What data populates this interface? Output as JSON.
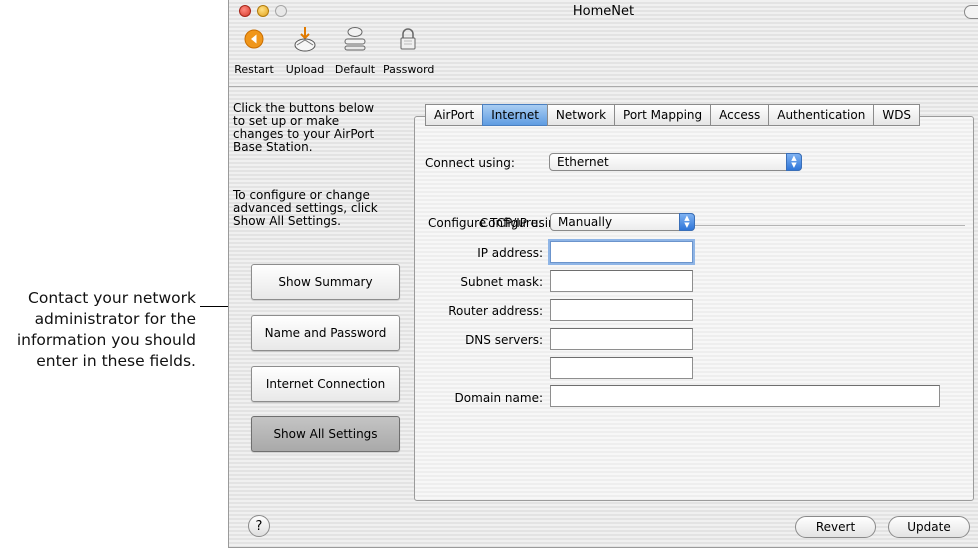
{
  "annotation": {
    "lines": [
      "Contact your network",
      "administrator for the",
      "information you should",
      "enter in these fields."
    ]
  },
  "window": {
    "title": "HomeNet"
  },
  "toolbar": {
    "items": [
      {
        "label": "Restart",
        "icon": "restart-icon"
      },
      {
        "label": "Upload",
        "icon": "upload-icon"
      },
      {
        "label": "Default",
        "icon": "default-icon"
      },
      {
        "label": "Password",
        "icon": "lock-icon"
      }
    ]
  },
  "sidebar": {
    "instructions_1": [
      "Click the buttons below",
      "to set up or make",
      "changes to your AirPort",
      "Base Station."
    ],
    "instructions_2": [
      "To configure or change",
      "advanced settings, click",
      "Show All Settings."
    ],
    "buttons": [
      {
        "label": "Show Summary"
      },
      {
        "label": "Name and Password"
      },
      {
        "label": "Internet Connection"
      },
      {
        "label": "Show All Settings",
        "active": true
      }
    ]
  },
  "tabs": [
    {
      "label": "AirPort"
    },
    {
      "label": "Internet",
      "active": true
    },
    {
      "label": "Network"
    },
    {
      "label": "Port Mapping"
    },
    {
      "label": "Access"
    },
    {
      "label": "Authentication"
    },
    {
      "label": "WDS"
    }
  ],
  "internet": {
    "connect_using_label": "Connect using:",
    "connect_using_value": "Ethernet",
    "group_title": "Configure TCP/IP using Ethernet",
    "configure_label": "Configure:",
    "configure_value": "Manually",
    "fields": {
      "ip_address_label": "IP address:",
      "ip_address_value": "",
      "subnet_mask_label": "Subnet mask:",
      "subnet_mask_value": "",
      "router_address_label": "Router address:",
      "router_address_value": "",
      "dns_servers_label": "DNS servers:",
      "dns_primary_value": "",
      "dns_secondary_value": "",
      "domain_name_label": "Domain name:",
      "domain_name_value": ""
    }
  },
  "footer": {
    "help": "?",
    "revert": "Revert",
    "update": "Update"
  },
  "colors": {
    "accent": "#5f9ce2",
    "close": "#d63a2b",
    "minimize": "#e2a21b"
  }
}
